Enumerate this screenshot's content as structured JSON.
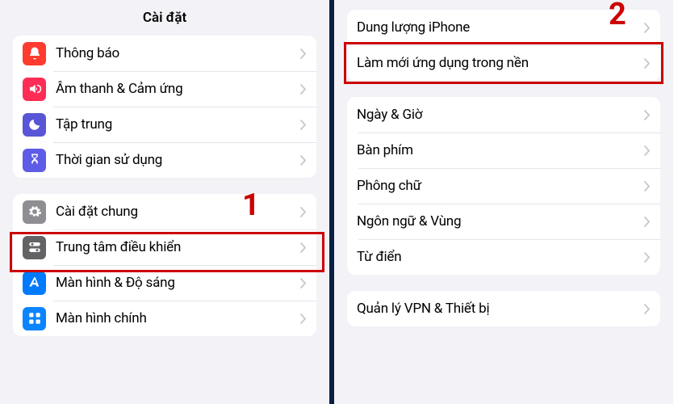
{
  "left": {
    "title": "Cài đặt",
    "group1": [
      {
        "label": "Thông báo"
      },
      {
        "label": "Âm thanh & Cảm ứng"
      },
      {
        "label": "Tập trung"
      },
      {
        "label": "Thời gian sử dụng"
      }
    ],
    "group2": [
      {
        "label": "Cài đặt chung"
      },
      {
        "label": "Trung tâm điều khiển"
      },
      {
        "label": "Màn hình & Độ sáng"
      },
      {
        "label": "Màn hình chính"
      }
    ],
    "step": "1"
  },
  "right": {
    "group1": [
      {
        "label": "Dung lượng iPhone"
      },
      {
        "label": "Làm mới ứng dụng trong nền"
      }
    ],
    "group2": [
      {
        "label": "Ngày & Giờ"
      },
      {
        "label": "Bàn phím"
      },
      {
        "label": "Phông chữ"
      },
      {
        "label": "Ngôn ngữ & Vùng"
      },
      {
        "label": "Từ điển"
      }
    ],
    "group3": [
      {
        "label": "Quản lý VPN & Thiết bị"
      }
    ],
    "step": "2"
  }
}
